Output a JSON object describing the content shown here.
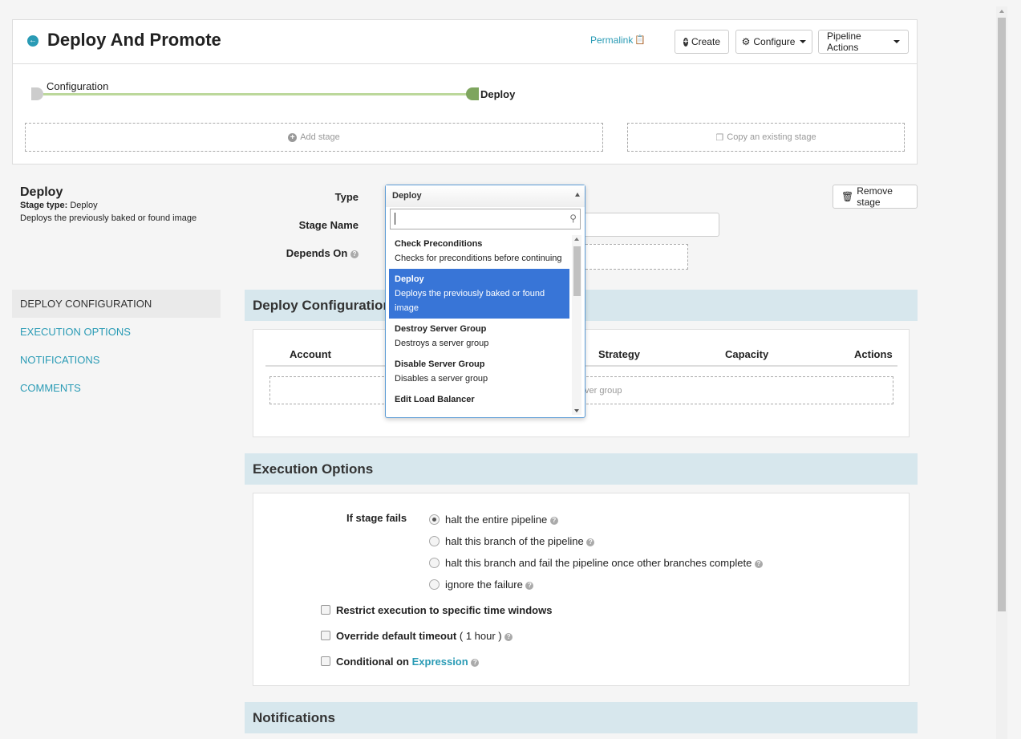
{
  "header": {
    "title": "Deploy And Promote",
    "permalink": "Permalink",
    "create": "Create",
    "configure": "Configure",
    "pipeline_actions": "Pipeline Actions"
  },
  "graph": {
    "node1": "Configuration",
    "node2": "Deploy",
    "add_stage": "Add stage",
    "copy_stage": "Copy an existing stage"
  },
  "stage": {
    "title": "Deploy",
    "type_label": "Stage type:",
    "type_value": "Deploy",
    "description": "Deploys the previously baked or found image",
    "remove": "Remove stage"
  },
  "form": {
    "type_label": "Type",
    "name_label": "Stage Name",
    "depends_label": "Depends On"
  },
  "dropdown": {
    "selected": "Deploy",
    "search_placeholder": "",
    "options": [
      {
        "name": "Check Preconditions",
        "desc": "Checks for preconditions before continuing"
      },
      {
        "name": "Deploy",
        "desc": "Deploys the previously baked or found image"
      },
      {
        "name": "Destroy Server Group",
        "desc": "Destroys a server group"
      },
      {
        "name": "Disable Server Group",
        "desc": "Disables a server group"
      },
      {
        "name": "Edit Load Balancer",
        "desc": ""
      }
    ]
  },
  "side_nav": {
    "items": [
      "DEPLOY CONFIGURATION",
      "EXECUTION OPTIONS",
      "NOTIFICATIONS",
      "COMMENTS"
    ]
  },
  "deploy_config": {
    "title": "Deploy Configuration",
    "columns": [
      "Account",
      "Strategy",
      "Capacity",
      "Actions"
    ],
    "add_server_group_partial": "ver group"
  },
  "execution_options": {
    "title": "Execution Options",
    "if_fails_label": "If stage fails",
    "radios": [
      "halt the entire pipeline",
      "halt this branch of the pipeline",
      "halt this branch and fail the pipeline once other branches complete",
      "ignore the failure"
    ],
    "restrict": "Restrict execution to specific time windows",
    "override": "Override default timeout",
    "override_hint": "( 1 hour )",
    "conditional": "Conditional on",
    "expression": "Expression"
  },
  "notifications": {
    "title": "Notifications"
  },
  "colors": {
    "accent": "#2a9bb5",
    "section_bg": "#d7e7ed",
    "selected": "#3875d7"
  }
}
